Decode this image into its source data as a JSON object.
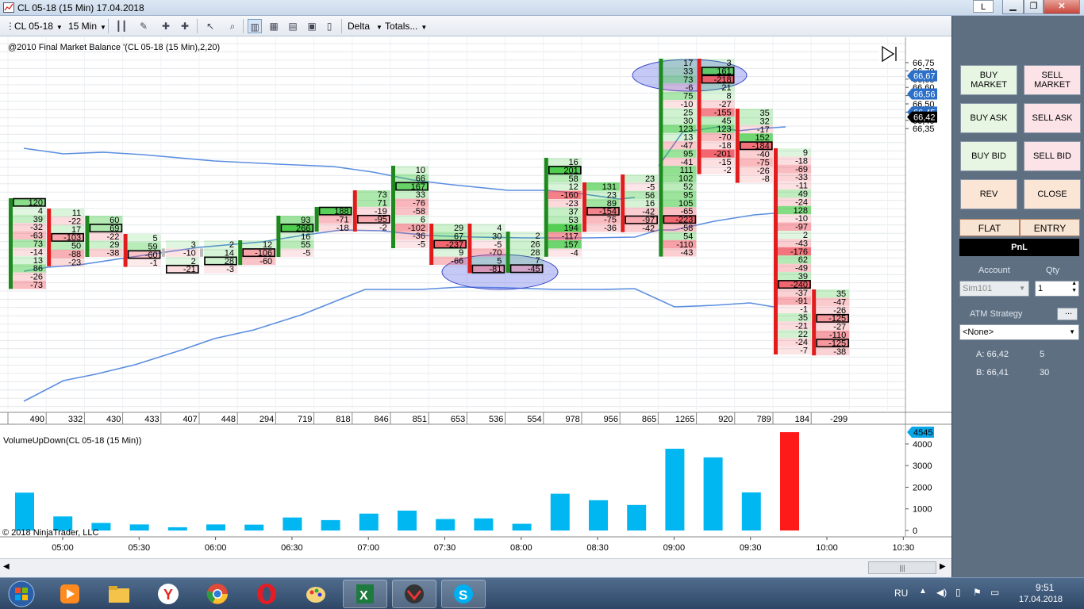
{
  "window": {
    "title": "CL 05-18 (15 Min)  17.04.2018",
    "layout_button": "L",
    "colors": {
      "bg": "#ffffff",
      "panel": "#5e6f82",
      "accent": "#0aa7e8"
    }
  },
  "toolbar": {
    "instrument": "CL 05-18",
    "interval": "15 Min",
    "indicator": "Delta",
    "totals": "Totals..."
  },
  "price_chart": {
    "indicator_label": "@2010 Final Market Balance  '(CL 05-18 (15 Min),2,20)",
    "y_ticks": [
      "66,75",
      "66,70",
      "66,65",
      "66,60",
      "66,55",
      "66,50",
      "66,45",
      "66,40",
      "66,35"
    ],
    "price_tags": [
      {
        "text": "66,67",
        "style": "blue"
      },
      {
        "text": "66,56",
        "style": "blue"
      },
      {
        "text": "66,45",
        "style": "blue"
      },
      {
        "text": "66,42",
        "style": "black"
      }
    ],
    "totals_row": [
      "490",
      "332",
      "430",
      "433",
      "407",
      "448",
      "294",
      "719",
      "818",
      "846",
      "851",
      "653",
      "536",
      "554",
      "978",
      "956",
      "865",
      "1265",
      "920",
      "789",
      "184",
      "-299"
    ],
    "footprint_bars": [
      {
        "delta": [
          "120",
          "4",
          "39",
          "-32",
          "-63",
          "73",
          "-14",
          "13",
          "86",
          "-26",
          "-73"
        ]
      },
      {
        "delta": [
          "11",
          "-22",
          "17",
          "-103",
          "50",
          "-88",
          "-23"
        ]
      },
      {
        "delta": [
          "60",
          "69",
          "-22",
          "29",
          "-38"
        ]
      },
      {
        "delta": [
          "5",
          "59",
          "-60",
          "-1"
        ]
      },
      {
        "delta": [
          "3",
          "-10",
          "2",
          "-21"
        ]
      },
      {
        "delta": [
          "2",
          "14",
          "28",
          "-3"
        ]
      },
      {
        "delta": [
          "12",
          "-106",
          "-60"
        ]
      },
      {
        "delta": [
          "93",
          "266",
          "16",
          "55",
          "-5"
        ]
      },
      {
        "delta": [
          "188",
          "-71",
          "-18"
        ]
      },
      {
        "delta": [
          "73",
          "71",
          "-19",
          "-95",
          "-2"
        ]
      },
      {
        "delta": [
          "10",
          "66",
          "167",
          "33",
          "-76",
          "-58",
          "6",
          "-102",
          "-36",
          "-5"
        ]
      },
      {
        "delta": [
          "29",
          "67",
          "-237",
          "9",
          "-66"
        ]
      },
      {
        "delta": [
          "4",
          "30",
          "-5",
          "-70",
          "5",
          "-81"
        ]
      },
      {
        "delta": [
          "2",
          "26",
          "28",
          "7",
          "-45"
        ]
      },
      {
        "delta": [
          "16",
          "201",
          "58",
          "12",
          "-160",
          "-23",
          "37",
          "53",
          "194",
          "-117",
          "157",
          "-4"
        ]
      },
      {
        "delta": [
          "131",
          "23",
          "89",
          "-154",
          "-75",
          "-36"
        ]
      },
      {
        "delta": [
          "23",
          "-5",
          "56",
          "16",
          "-42",
          "-97",
          "-42"
        ]
      },
      {
        "delta": [
          "17",
          "33",
          "73",
          "-6",
          "75",
          "-10",
          "25",
          "30",
          "123",
          "13",
          "-47",
          "95",
          "-41",
          "111",
          "102",
          "52",
          "95",
          "105",
          "-65",
          "-223",
          "-58",
          "54",
          "-110",
          "-43"
        ]
      },
      {
        "delta": [
          "3",
          "161",
          "-218",
          "21",
          "8",
          "-27",
          "-155",
          "45",
          "123",
          "-70",
          "-18",
          "-201",
          "-15",
          "-2"
        ]
      },
      {
        "delta": [
          "35",
          "32",
          "-17",
          "152",
          "-184",
          "-40",
          "-75",
          "-26",
          "-8"
        ]
      },
      {
        "delta": [
          "9",
          "-18",
          "-69",
          "-33",
          "-11",
          "49",
          "-24",
          "128",
          "-10",
          "-97",
          "2",
          "-43",
          "-176",
          "62",
          "-49",
          "39",
          "-240",
          "-37",
          "-91",
          "-1",
          "35",
          "-21",
          "22",
          "-24",
          "-7"
        ]
      },
      {
        "delta": [
          "35",
          "-47",
          "-26",
          "-125",
          "-27",
          "-110",
          "-125",
          "-38"
        ]
      }
    ]
  },
  "volume_chart": {
    "label": "VolumeUpDown(CL 05-18 (15 Min))",
    "copyright": "© 2018 NinjaTrader, LLC",
    "current_tag": "4545",
    "y_ticks": [
      "4000",
      "3000",
      "2000",
      "1000",
      "0"
    ],
    "x_ticks": [
      "05:00",
      "05:30",
      "06:00",
      "06:30",
      "07:00",
      "07:30",
      "08:00",
      "08:30",
      "09:00",
      "09:30",
      "10:00",
      "10:30"
    ]
  },
  "chart_data": {
    "type": "bar",
    "title": "VolumeUpDown(CL 05-18 (15 Min))",
    "xlabel": "",
    "ylabel": "",
    "ylim": [
      0,
      4545
    ],
    "categories": [
      "04:45",
      "05:00",
      "05:15",
      "05:30",
      "05:45",
      "06:00",
      "06:15",
      "06:30",
      "06:45",
      "07:00",
      "07:15",
      "07:30",
      "07:45",
      "08:00",
      "08:15",
      "08:30",
      "08:45",
      "09:00",
      "09:15",
      "09:30",
      "09:45"
    ],
    "series": [
      {
        "name": "up",
        "color": "#00b7f1",
        "values": [
          1750,
          650,
          350,
          280,
          150,
          280,
          270,
          600,
          480,
          780,
          920,
          530,
          560,
          310,
          1700,
          1400,
          1180,
          3780,
          3380,
          1760,
          0
        ]
      },
      {
        "name": "down",
        "color": "#ff1a1a",
        "values": [
          0,
          0,
          0,
          0,
          0,
          0,
          0,
          0,
          0,
          0,
          0,
          0,
          0,
          0,
          0,
          0,
          0,
          0,
          0,
          0,
          4545
        ]
      }
    ]
  },
  "panel": {
    "buttons": {
      "buy_market": "BUY MARKET",
      "sell_market": "SELL MARKET",
      "buy_ask": "BUY ASK",
      "sell_ask": "SELL ASK",
      "buy_bid": "BUY BID",
      "sell_bid": "SELL BID",
      "rev": "REV",
      "close": "CLOSE"
    },
    "flat": "FLAT",
    "entry": "ENTRY",
    "pnl": "PnL",
    "account_label": "Account",
    "account_value": "Sim101",
    "qty_label": "Qty",
    "qty_value": "1",
    "atm_label": "ATM Strategy",
    "atm_value": "<None>",
    "ask_label": "A: 66,42",
    "ask_size": "5",
    "bid_label": "B: 66,41",
    "bid_size": "30"
  },
  "taskbar": {
    "lang": "RU",
    "time": "9:51",
    "date": "17.04.2018"
  }
}
